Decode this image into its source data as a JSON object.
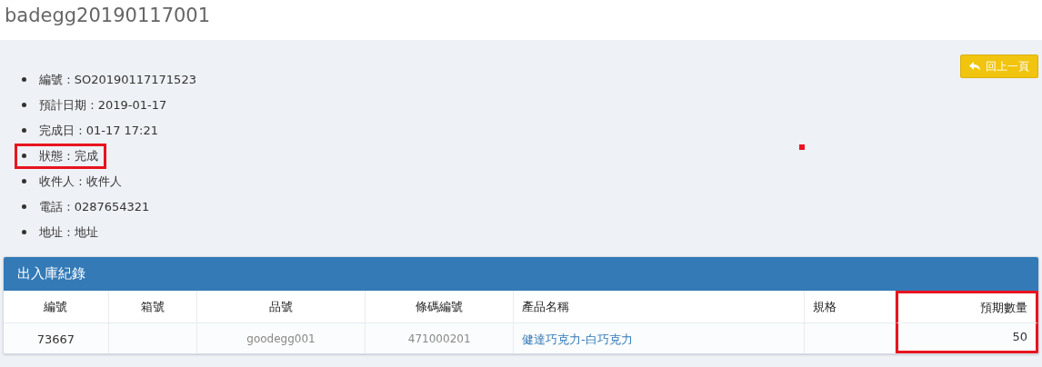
{
  "page_title": "badegg20190117001",
  "back_button": {
    "label": "回上一頁"
  },
  "details": [
    {
      "text": "編號 : SO20190117171523",
      "highlighted": false
    },
    {
      "text": "預計日期 : 2019-01-17",
      "highlighted": false
    },
    {
      "text": "完成日 : 01-17 17:21",
      "highlighted": false
    },
    {
      "text": "狀態 : 完成",
      "highlighted": true
    },
    {
      "text": "收件人 : 收件人",
      "highlighted": false
    },
    {
      "text": "電話 : 0287654321",
      "highlighted": false
    },
    {
      "text": "地址 : 地址",
      "highlighted": false
    }
  ],
  "panel": {
    "title": "出入庫紀錄",
    "table": {
      "columns": [
        {
          "label": "編號",
          "highlighted": false
        },
        {
          "label": "箱號",
          "highlighted": false
        },
        {
          "label": "品號",
          "highlighted": false
        },
        {
          "label": "條碼編號",
          "highlighted": false
        },
        {
          "label": "產品名稱",
          "highlighted": false
        },
        {
          "label": "規格",
          "highlighted": false
        },
        {
          "label": "預期數量",
          "highlighted": true
        }
      ],
      "rows": [
        {
          "cells": [
            {
              "text": "73667",
              "kind": "plain"
            },
            {
              "text": "",
              "kind": "plain"
            },
            {
              "text": "goodegg001",
              "kind": "muted"
            },
            {
              "text": "471000201",
              "kind": "muted"
            },
            {
              "text": "健達巧克力-白巧克力",
              "kind": "link"
            },
            {
              "text": "",
              "kind": "plain"
            },
            {
              "text": "50",
              "kind": "plain"
            }
          ]
        }
      ]
    }
  }
}
